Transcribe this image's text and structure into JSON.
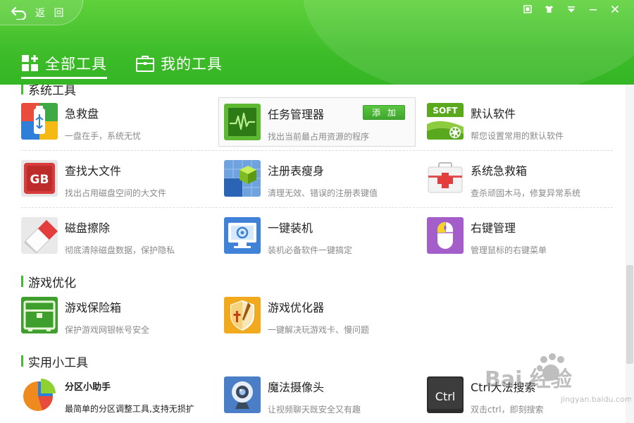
{
  "header": {
    "back_label": "返 回",
    "tabs": [
      {
        "label": "全部工具",
        "icon": "grid-plus-icon",
        "active": true
      },
      {
        "label": "我的工具",
        "icon": "toolbox-icon",
        "active": false
      }
    ],
    "window_controls": [
      "skin-icon",
      "shirt-icon",
      "menu-icon",
      "minimize-icon",
      "close-icon"
    ]
  },
  "sections": [
    {
      "title": "系统工具"
    },
    {
      "title": "游戏优化"
    },
    {
      "title": "实用小工具"
    }
  ],
  "tools": {
    "jijiupan": {
      "name": "急救盘",
      "desc": "一盘在手，系统无忧",
      "icon": "usb-drive-icon"
    },
    "renwu": {
      "name": "任务管理器",
      "desc": "找出当前最占用资源的程序",
      "icon": "heartbeat-monitor-icon",
      "add_label": "添加"
    },
    "moren": {
      "name": "默认软件",
      "desc": "帮您设置常用的默认软件",
      "icon": "soft-gear-icon",
      "icon_text": "SOFT"
    },
    "chazhao": {
      "name": "查找大文件",
      "desc": "找出占用磁盘空间的大文件",
      "icon": "gb-file-icon",
      "icon_text": "GB"
    },
    "zhuce": {
      "name": "注册表瘦身",
      "desc": "清理无效、错误的注册表键值",
      "icon": "registry-cube-icon"
    },
    "xitong": {
      "name": "系统急救箱",
      "desc": "查杀顽固木马，修复异常系统",
      "icon": "first-aid-kit-icon"
    },
    "cipan": {
      "name": "磁盘擦除",
      "desc": "彻底清除磁盘数据，保护隐私",
      "icon": "eraser-icon"
    },
    "yijian": {
      "name": "一键装机",
      "desc": "装机必备软件一键搞定",
      "icon": "monitor-install-icon"
    },
    "youjian": {
      "name": "右键管理",
      "desc": "管理鼠标的右键菜单",
      "icon": "mouse-icon"
    },
    "youxibao": {
      "name": "游戏保险箱",
      "desc": "保护游戏网银帐号安全",
      "icon": "safe-box-icon"
    },
    "youxiyou": {
      "name": "游戏优化器",
      "desc": "一键解决玩游戏卡、慢问题",
      "icon": "shield-sword-icon"
    },
    "fenqu": {
      "name": "分区小助手",
      "desc": "最简单的分区调整工具,支持无损扩",
      "icon": "pie-chart-icon"
    },
    "mofa": {
      "name": "魔法摄像头",
      "desc": "让视频聊天既安全又有趣",
      "icon": "webcam-icon"
    },
    "ctrl": {
      "name": "Ctrl大法搜索",
      "desc": "双击ctrl，即刻搜索",
      "icon": "ctrl-key-icon",
      "icon_text": "Ctrl"
    }
  },
  "watermark": {
    "brand": "Bai 经验",
    "url": "jingyan.baidu.com"
  },
  "colors": {
    "brand_green": "#3fbd2a",
    "add_button": "#4cb636"
  }
}
